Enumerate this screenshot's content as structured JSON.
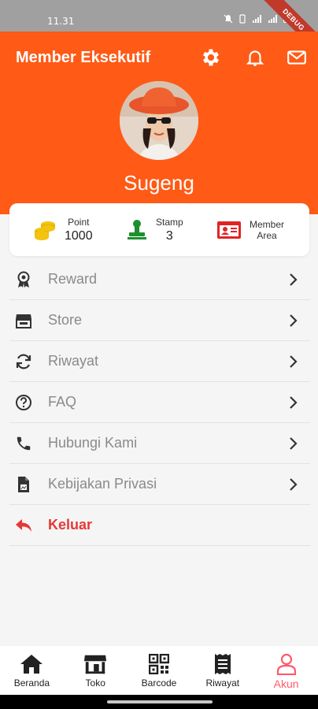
{
  "status_bar": {
    "time": "11.31",
    "debug_label": "DEBUG"
  },
  "header": {
    "title": "Member Eksekutif",
    "user_name": "Sugeng"
  },
  "stats": {
    "point": {
      "label": "Point",
      "value": "1000"
    },
    "stamp": {
      "label": "Stamp",
      "value": "3"
    },
    "member_area": {
      "label_line1": "Member",
      "label_line2": "Area"
    }
  },
  "menu": {
    "items": [
      {
        "label": "Reward",
        "icon": "award-icon"
      },
      {
        "label": "Store",
        "icon": "store-icon"
      },
      {
        "label": "Riwayat",
        "icon": "sync-icon"
      },
      {
        "label": "FAQ",
        "icon": "help-circle-icon"
      },
      {
        "label": "Hubungi Kami",
        "icon": "phone-icon"
      },
      {
        "label": "Kebijakan Privasi",
        "icon": "document-icon"
      }
    ],
    "logout_label": "Keluar"
  },
  "bottom_nav": {
    "items": [
      {
        "label": "Beranda",
        "icon": "home-icon"
      },
      {
        "label": "Toko",
        "icon": "store-icon"
      },
      {
        "label": "Barcode",
        "icon": "qrcode-icon"
      },
      {
        "label": "Riwayat",
        "icon": "receipt-icon"
      },
      {
        "label": "Akun",
        "icon": "user-icon",
        "active": true
      }
    ]
  },
  "colors": {
    "accent": "#ff5a16",
    "logout": "#e53935",
    "active_nav": "#ff5a6a",
    "stamp": "#1e8f2f",
    "coin": "#f2c40f",
    "member_card": "#e02424"
  }
}
